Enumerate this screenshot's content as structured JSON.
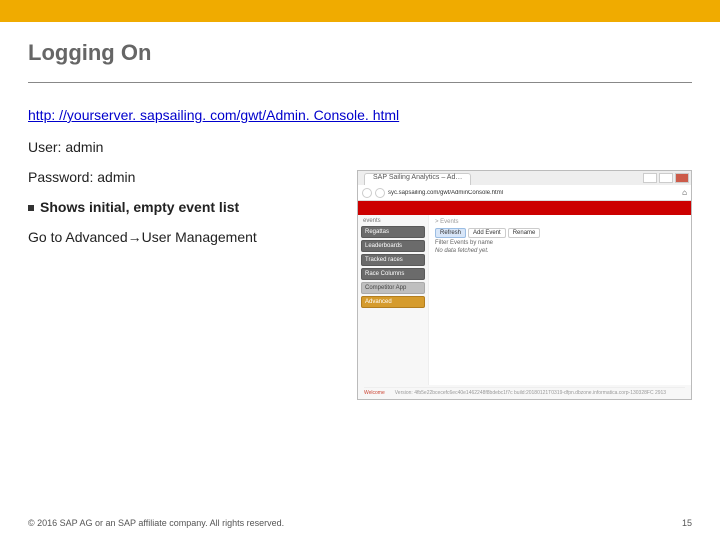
{
  "title": "Logging On",
  "url": "http: //yourserver. sapsailing. com/gwt/Admin. Console. html",
  "user_line": "User: admin",
  "pwd_line": "Password: admin",
  "bullet": "Shows initial, empty event list",
  "goto_prefix": "Go to Advanced",
  "goto_arrow": "→",
  "goto_suffix": "User Management",
  "footer_left": "© 2016 SAP AG or an SAP affiliate company. All rights reserved.",
  "footer_right": "15",
  "shot": {
    "tab": "SAP Sailing Analytics – Ad…",
    "addr": "syc.sapsailing.com/gwt/AdminConsole.html",
    "side_label": "events",
    "side": [
      {
        "label": "Regattas",
        "cls": "dk"
      },
      {
        "label": "Leaderboards",
        "cls": "dk"
      },
      {
        "label": "Tracked races",
        "cls": "dk"
      },
      {
        "label": "Race Columns",
        "cls": "dk"
      },
      {
        "label": "Competitor App",
        "cls": ""
      },
      {
        "label": "Advanced",
        "cls": "sel"
      }
    ],
    "crumb_grey": "> Events",
    "toolbar": [
      "Refresh",
      "Add Event",
      "Rename"
    ],
    "line1": "Filter Events by name",
    "line2": "No data fetched yet.",
    "welcome": "Welcome",
    "ver": "Version: 4fb5e22bcecefc6ec40e1462248f8bdebc1f7c build:20180121T0319-dfpn.dbzone.informatica.corp-130328FC 2913"
  }
}
